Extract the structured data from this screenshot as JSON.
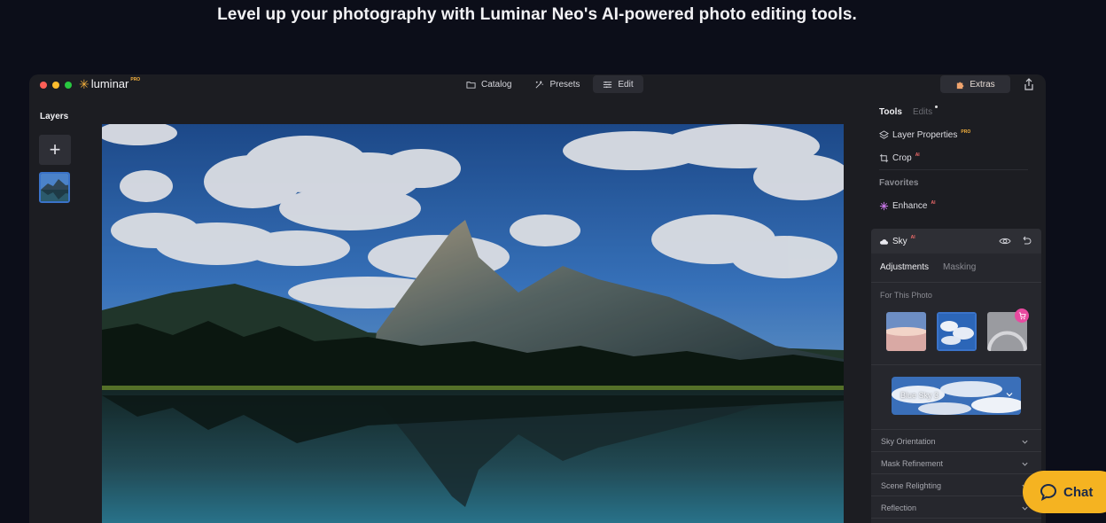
{
  "headline": "Level up your photography with Luminar Neo's AI-powered photo editing tools.",
  "app": {
    "brand": "luminar",
    "brand_badge": "PRO",
    "window_dots": [
      "#ff5f57",
      "#febc2e",
      "#28c840"
    ],
    "nav": [
      {
        "label": "Catalog",
        "icon": "folder-icon"
      },
      {
        "label": "Presets",
        "icon": "presets-icon"
      },
      {
        "label": "Edit",
        "icon": "sliders-icon"
      }
    ],
    "active_nav": "Edit",
    "extras_label": "Extras"
  },
  "layers": {
    "title": "Layers",
    "add_icon": "plus-icon"
  },
  "panel": {
    "tab_tools": "Tools",
    "tab_edits": "Edits",
    "layer_properties": "Layer Properties",
    "layer_properties_badge": "PRO",
    "crop": "Crop",
    "crop_badge": "AI",
    "favorites": "Favorites",
    "enhance": "Enhance",
    "enhance_badge": "AI"
  },
  "sky": {
    "title": "Sky",
    "title_badge": "AI",
    "tab_adjustments": "Adjustments",
    "tab_masking": "Masking",
    "for_this_photo": "For This Photo",
    "selected_sky": "Blue Sky 3",
    "sections": [
      "Sky Orientation",
      "Mask Refinement",
      "Scene Relighting",
      "Reflection"
    ]
  },
  "chat_label": "Chat",
  "colors": {
    "accent_blue": "#3a73c9",
    "brand_gold": "#f5b13d",
    "chat_button": "#f5b321",
    "cart_badge": "#e84aa0"
  }
}
